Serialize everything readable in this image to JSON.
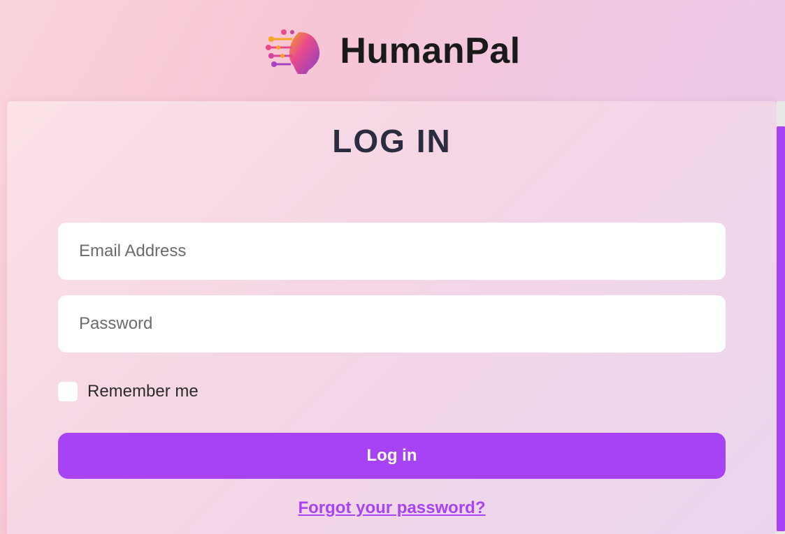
{
  "brand": {
    "name": "HumanPal"
  },
  "page": {
    "title": "LOG IN"
  },
  "form": {
    "email": {
      "placeholder": "Email Address",
      "value": ""
    },
    "password": {
      "placeholder": "Password",
      "value": ""
    },
    "remember": {
      "label": "Remember me",
      "checked": false
    },
    "submit_label": "Log in",
    "forgot_label": "Forgot your password?"
  },
  "colors": {
    "accent": "#a742f5",
    "text_dark": "#2b2d3e"
  }
}
